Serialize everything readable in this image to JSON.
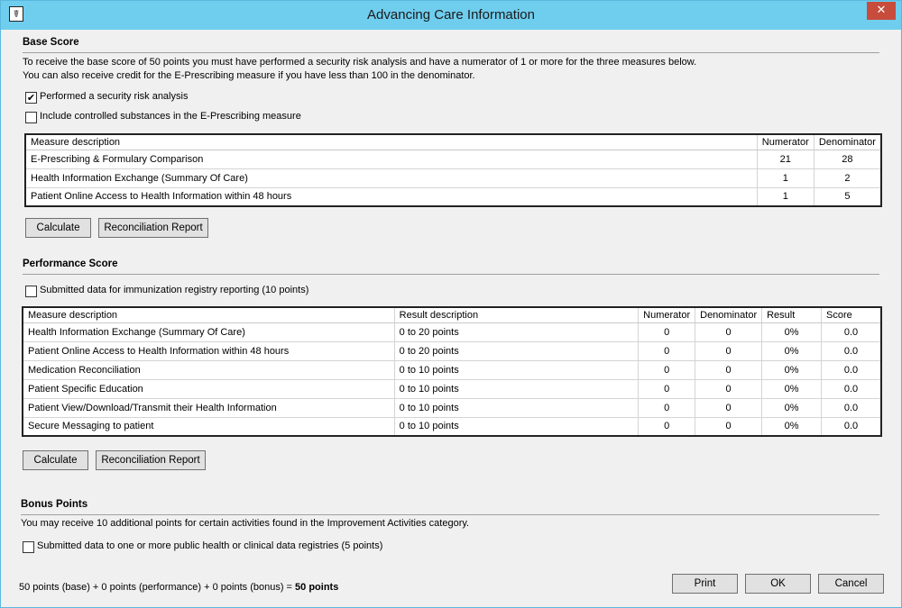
{
  "window": {
    "title": "Advancing Care Information",
    "close_glyph": "✕",
    "icon_glyph": "☤"
  },
  "base": {
    "title": "Base Score",
    "intro1": "To receive the base score of 50 points you must have performed a security risk analysis and have a numerator of 1 or more for the three measures below.",
    "intro2": "You can also receive credit for the E-Prescribing measure if you have less than 100 in the denominator.",
    "chk1": {
      "label": "Performed a security risk analysis",
      "checked": true,
      "glyph": "✔"
    },
    "chk2": {
      "label": "Include controlled substances in the E-Prescribing measure",
      "checked": false
    },
    "headers": [
      "Measure description",
      "Numerator",
      "Denominator"
    ],
    "rows": [
      {
        "desc": "E-Prescribing & Formulary Comparison",
        "num": "21",
        "den": "28"
      },
      {
        "desc": "Health Information Exchange (Summary Of Care)",
        "num": "1",
        "den": "2"
      },
      {
        "desc": "Patient Online Access to Health Information within 48 hours",
        "num": "1",
        "den": "5"
      }
    ],
    "calculate": "Calculate",
    "report": "Reconciliation Report"
  },
  "perf": {
    "title": "Performance Score",
    "chk": {
      "label": "Submitted data for immunization registry reporting (10 points)",
      "checked": false
    },
    "headers": [
      "Measure description",
      "Result description",
      "Numerator",
      "Denominator",
      "Result",
      "Score"
    ],
    "rows": [
      {
        "desc": "Health Information Exchange (Summary Of Care)",
        "result_desc": "0 to 20 points",
        "num": "0",
        "den": "0",
        "result": "0%",
        "score": "0.0"
      },
      {
        "desc": "Patient Online Access to Health Information within 48 hours",
        "result_desc": "0 to 20 points",
        "num": "0",
        "den": "0",
        "result": "0%",
        "score": "0.0"
      },
      {
        "desc": "Medication Reconciliation",
        "result_desc": "0 to 10 points",
        "num": "0",
        "den": "0",
        "result": "0%",
        "score": "0.0"
      },
      {
        "desc": "Patient Specific Education",
        "result_desc": "0 to 10 points",
        "num": "0",
        "den": "0",
        "result": "0%",
        "score": "0.0"
      },
      {
        "desc": "Patient View/Download/Transmit their Health Information",
        "result_desc": "0 to 10 points",
        "num": "0",
        "den": "0",
        "result": "0%",
        "score": "0.0"
      },
      {
        "desc": "Secure Messaging to patient",
        "result_desc": "0 to 10 points",
        "num": "0",
        "den": "0",
        "result": "0%",
        "score": "0.0"
      }
    ],
    "calculate": "Calculate",
    "report": "Reconciliation Report"
  },
  "bonus": {
    "title": "Bonus Points",
    "intro": "You may receive 10 additional points for certain activities found in the Improvement Activities category.",
    "chk": {
      "label": "Submitted data to one or more public health or clinical data registries (5 points)",
      "checked": false
    }
  },
  "footer": {
    "summary": "50 points (base) + 0 points (performance) + 0 points (bonus) = ",
    "total": "50 points",
    "print": "Print",
    "ok": "OK",
    "cancel": "Cancel"
  }
}
